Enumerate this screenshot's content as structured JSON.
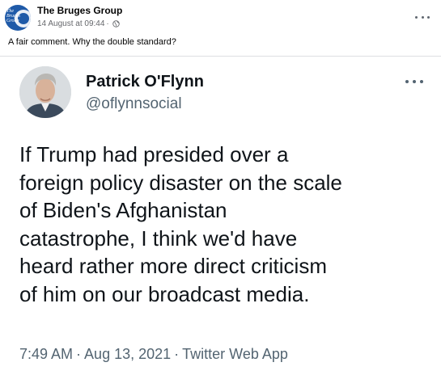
{
  "facebook_post": {
    "page_name": "The Bruges Group",
    "avatar_logo_text": "The Bruges Group",
    "date": "14 August at 09:44",
    "meta_separator": "·",
    "post_text": "A fair comment. Why the double standard?"
  },
  "tweet": {
    "author_name": "Patrick O'Flynn",
    "handle": "@oflynnsocial",
    "text_lines": [
      "If Trump had presided over a",
      "foreign policy disaster on the scale",
      "of Biden's Afghanistan",
      "catastrophe, I think we'd have",
      "heard rather more direct criticism",
      "of him on our broadcast media."
    ],
    "time": "7:49 AM",
    "date": "Aug 13, 2021",
    "source": "Twitter Web App",
    "separator": "·"
  },
  "icons": {
    "fb_more": "more-horizontal-icon",
    "tweet_more": "more-horizontal-icon",
    "audience": "globe-icon"
  }
}
